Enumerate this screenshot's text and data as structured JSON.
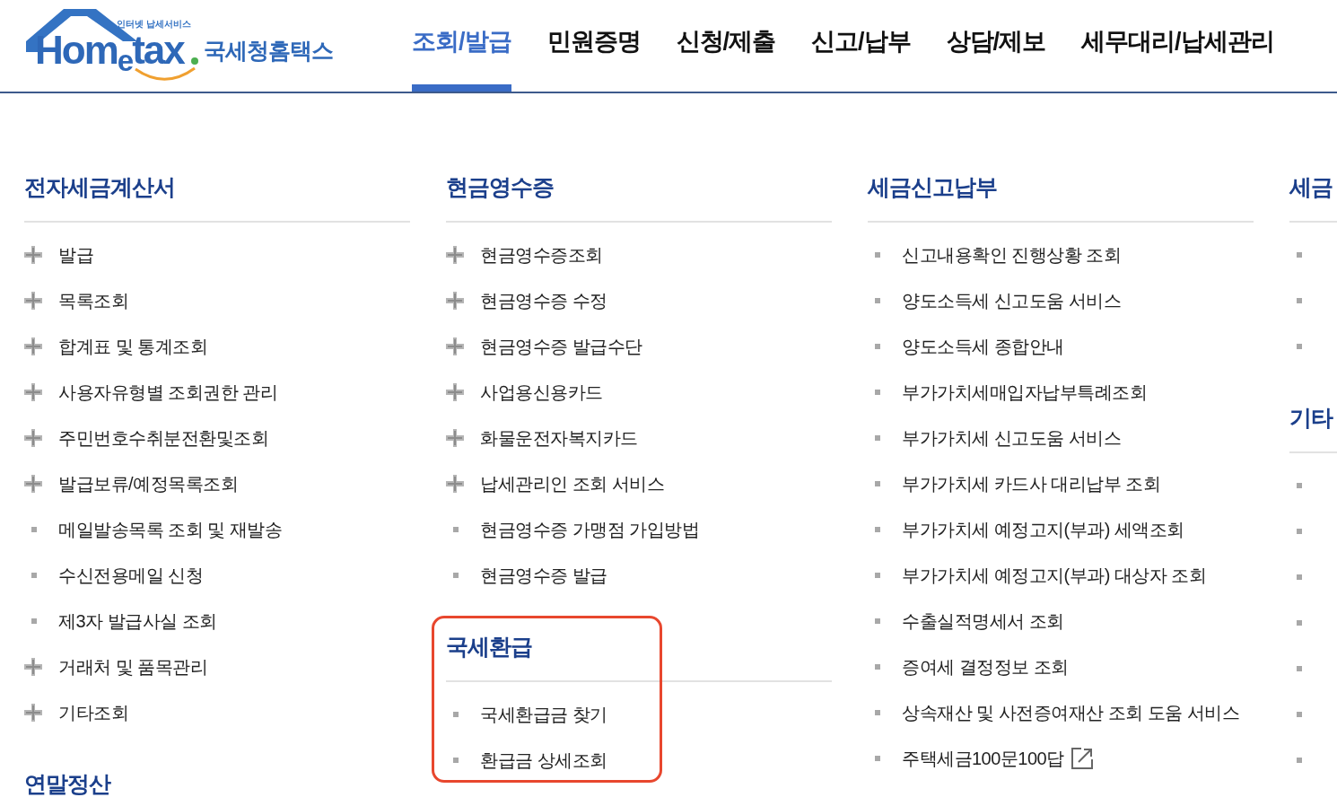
{
  "logo": {
    "tagline": "인터넷 납세서비스",
    "wordmark": "Hom$_{e}$tax",
    "subtitle": "국세청홈택스"
  },
  "nav": [
    {
      "label": "조회/발급",
      "selected": true
    },
    {
      "label": "민원증명",
      "selected": false
    },
    {
      "label": "신청/제출",
      "selected": false
    },
    {
      "label": "신고/납부",
      "selected": false
    },
    {
      "label": "상담/제보",
      "selected": false
    },
    {
      "label": "세무대리/납세관리",
      "selected": false
    }
  ],
  "columns": [
    {
      "sections": [
        {
          "title": "전자세금계산서",
          "highlighted": false,
          "items": [
            {
              "label": "발급",
              "kind": "plus"
            },
            {
              "label": "목록조회",
              "kind": "plus"
            },
            {
              "label": "합계표 및 통계조회",
              "kind": "plus"
            },
            {
              "label": "사용자유형별 조회권한 관리",
              "kind": "plus"
            },
            {
              "label": "주민번호수취분전환및조회",
              "kind": "plus"
            },
            {
              "label": "발급보류/예정목록조회",
              "kind": "plus"
            },
            {
              "label": "메일발송목록 조회 및 재발송",
              "kind": "square"
            },
            {
              "label": "수신전용메일 신청",
              "kind": "square"
            },
            {
              "label": "제3자 발급사실 조회",
              "kind": "square"
            },
            {
              "label": "거래처 및 품목관리",
              "kind": "plus"
            },
            {
              "label": "기타조회",
              "kind": "plus"
            }
          ]
        },
        {
          "title": "연말정산",
          "highlighted": false
        }
      ]
    },
    {
      "sections": [
        {
          "title": "현금영수증",
          "highlighted": false,
          "items": [
            {
              "label": "현금영수증조회",
              "kind": "plus"
            },
            {
              "label": "현금영수증 수정",
              "kind": "plus"
            },
            {
              "label": "현금영수증 발급수단",
              "kind": "plus"
            },
            {
              "label": "사업용신용카드",
              "kind": "plus"
            },
            {
              "label": "화물운전자복지카드",
              "kind": "plus"
            },
            {
              "label": "납세관리인 조회 서비스",
              "kind": "plus"
            },
            {
              "label": "현금영수증 가맹점 가입방법",
              "kind": "square"
            },
            {
              "label": "현금영수증 발급",
              "kind": "square"
            }
          ]
        },
        {
          "title": "국세환급",
          "highlighted": true,
          "items": [
            {
              "label": "국세환급금 찾기",
              "kind": "square"
            },
            {
              "label": "환급금 상세조회",
              "kind": "square"
            }
          ]
        }
      ]
    },
    {
      "sections": [
        {
          "title": "세금신고납부",
          "highlighted": false,
          "items": [
            {
              "label": "신고내용확인 진행상황 조회",
              "kind": "square"
            },
            {
              "label": "양도소득세 신고도움 서비스",
              "kind": "square"
            },
            {
              "label": "양도소득세 종합안내",
              "kind": "square"
            },
            {
              "label": "부가가치세매입자납부특례조회",
              "kind": "square"
            },
            {
              "label": "부가가치세 신고도움 서비스",
              "kind": "square"
            },
            {
              "label": "부가가치세 카드사 대리납부 조회",
              "kind": "square"
            },
            {
              "label": "부가가치세 예정고지(부과) 세액조회",
              "kind": "square"
            },
            {
              "label": "부가가치세 예정고지(부과) 대상자 조회",
              "kind": "square"
            },
            {
              "label": "수출실적명세서 조회",
              "kind": "square"
            },
            {
              "label": "증여세 결정정보 조회",
              "kind": "square"
            },
            {
              "label": "상속재산 및 사전증여재산 조회 도움 서비스",
              "kind": "square"
            },
            {
              "label": "주택세금100문100답",
              "kind": "external"
            }
          ]
        }
      ]
    },
    {
      "sections": [
        {
          "title": "세금",
          "highlighted": false,
          "items": [
            {
              "kind": "square"
            },
            {
              "kind": "square"
            },
            {
              "kind": "square"
            }
          ]
        },
        {
          "title": "기타",
          "highlighted": false,
          "items": [
            {
              "kind": "square"
            },
            {
              "kind": "square"
            },
            {
              "kind": "square"
            },
            {
              "kind": "square"
            },
            {
              "kind": "square"
            },
            {
              "kind": "square"
            },
            {
              "kind": "square"
            }
          ]
        }
      ]
    }
  ]
}
